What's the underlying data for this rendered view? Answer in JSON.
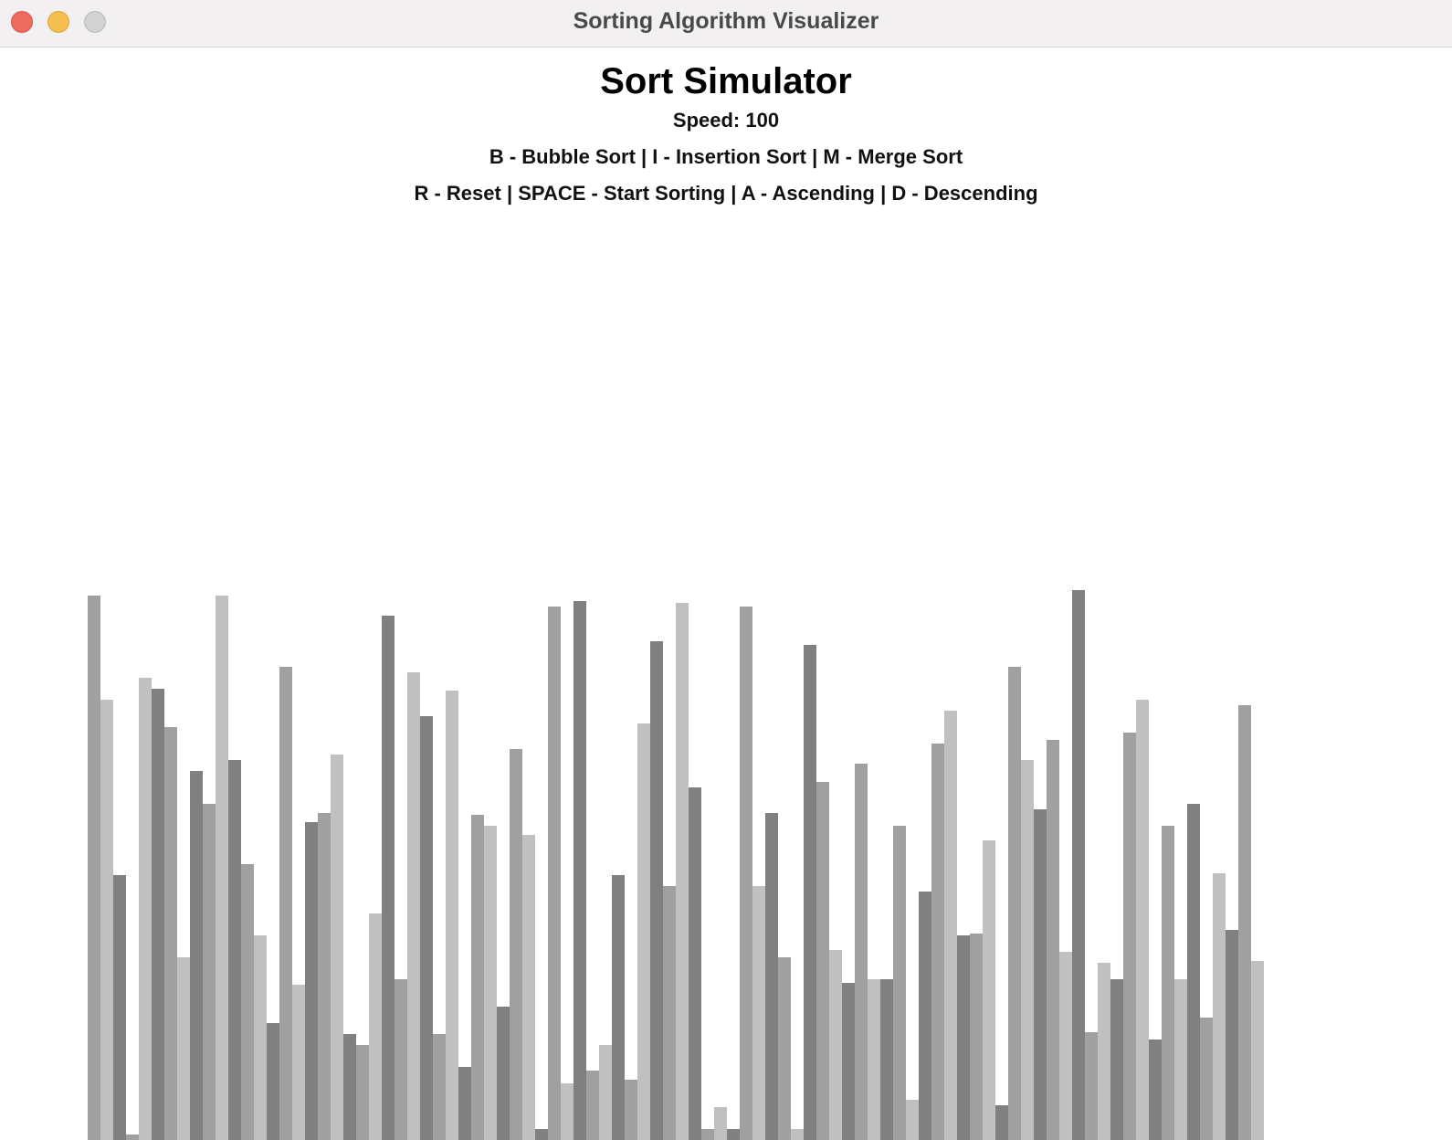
{
  "window": {
    "title": "Sorting Algorithm Visualizer"
  },
  "app": {
    "heading": "Sort Simulator",
    "speed_label": "Speed: 100",
    "algorithms_line": "B - Bubble Sort | I - Insertion Sort | M - Merge Sort",
    "controls_line": "R - Reset | SPACE - Start Sorting | A - Ascending | D - Descending"
  },
  "colors": {
    "bar_dark": "#808080",
    "bar_mid": "#a0a0a0",
    "bar_light": "#c0c0c0",
    "background": "#ffffff"
  },
  "bars": {
    "count": 100,
    "values": [
      590,
      476,
      284,
      0,
      500,
      488,
      446,
      194,
      398,
      362,
      590,
      410,
      296,
      218,
      122,
      512,
      164,
      342,
      352,
      416,
      110,
      98,
      242,
      568,
      170,
      506,
      458,
      110,
      486,
      74,
      350,
      338,
      140,
      422,
      328,
      6,
      578,
      56,
      584,
      70,
      98,
      284,
      60,
      450,
      540,
      272,
      582,
      380,
      6,
      30,
      6,
      578,
      272,
      352,
      194,
      6,
      536,
      386,
      202,
      166,
      406,
      170,
      170,
      338,
      38,
      266,
      428,
      464,
      218,
      220,
      322,
      32,
      512,
      410,
      356,
      432,
      200,
      596,
      112,
      188,
      170,
      440,
      476,
      104,
      338,
      170,
      362,
      128,
      286,
      224,
      470,
      190
    ]
  }
}
